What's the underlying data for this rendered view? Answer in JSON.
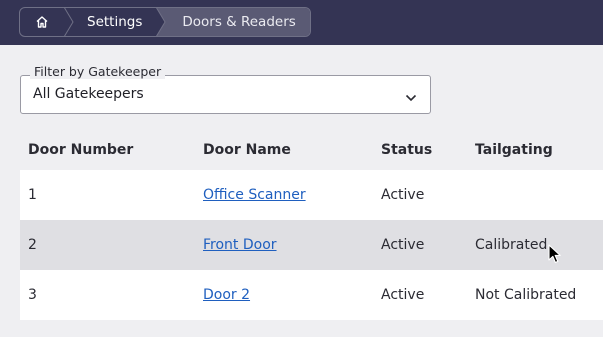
{
  "breadcrumb": {
    "home_icon": "home-icon",
    "items": [
      "Settings",
      "Doors & Readers"
    ]
  },
  "filter": {
    "label": "Filter by Gatekeeper",
    "value": "All Gatekeepers",
    "icon": "chevron-down-icon"
  },
  "table": {
    "headers": [
      "Door Number",
      "Door Name",
      "Status",
      "Tailgating"
    ],
    "rows": [
      {
        "number": "1",
        "name": "Office Scanner",
        "status": "Active",
        "tailgating": ""
      },
      {
        "number": "2",
        "name": "Front Door",
        "status": "Active",
        "tailgating": "Calibrated"
      },
      {
        "number": "3",
        "name": "Door 2",
        "status": "Active",
        "tailgating": "Not Calibrated"
      }
    ]
  },
  "colors": {
    "topbar": "#343454",
    "link": "#1f5fbf",
    "row_highlight": "#dfdfe3"
  }
}
